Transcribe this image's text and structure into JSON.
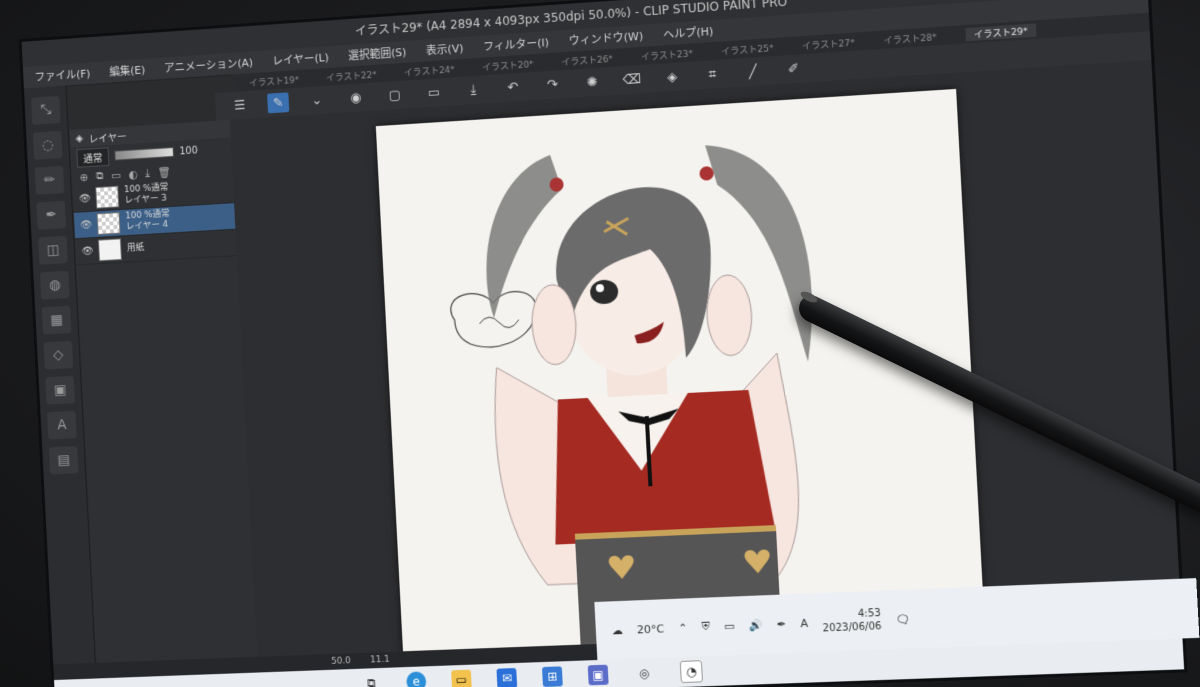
{
  "window": {
    "title": "イラスト29* (A4 2894 x 4093px 350dpi 50.0%) - CLIP STUDIO PAINT PRO"
  },
  "menu": [
    "ファイル(F)",
    "編集(E)",
    "アニメーション(A)",
    "レイヤー(L)",
    "選択範囲(S)",
    "表示(V)",
    "フィルター(I)",
    "ウィンドウ(W)",
    "ヘルプ(H)"
  ],
  "tabs": [
    "イラスト19*",
    "イラスト22*",
    "イラスト24*",
    "イラスト20*",
    "イラスト26*",
    "イラスト23*",
    "イラスト25*",
    "イラスト27*",
    "イラスト28*",
    "イラスト29*"
  ],
  "active_tab": "イラスト29*",
  "layer_panel": {
    "title": "レイヤー",
    "blend_mode": "通常",
    "opacity": "100",
    "layers": [
      {
        "opacity_mode": "100 %通常",
        "name": "レイヤー 3",
        "selected": false
      },
      {
        "opacity_mode": "100 %通常",
        "name": "レイヤー 4",
        "selected": true
      },
      {
        "opacity_mode": "",
        "name": "用紙",
        "selected": false
      }
    ]
  },
  "status": {
    "zoom": "50.0",
    "value2": "11.1"
  },
  "tray": {
    "temperature": "20°C",
    "ime": "A",
    "time": "4:53",
    "date": "2023/06/06"
  },
  "colors": {
    "accent": "#3a6fb0",
    "dress_red": "#a52a22",
    "skin": "#f6e6df",
    "hair": "#6b6b6b"
  }
}
